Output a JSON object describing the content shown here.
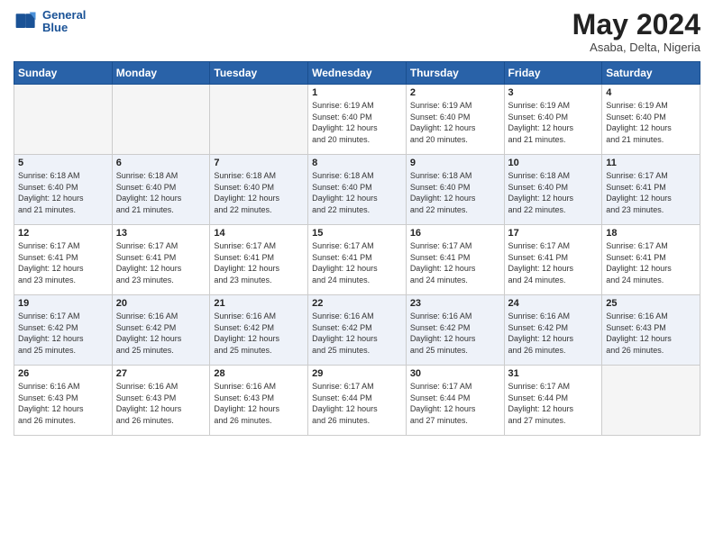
{
  "logo": {
    "line1": "General",
    "line2": "Blue"
  },
  "title": "May 2024",
  "subtitle": "Asaba, Delta, Nigeria",
  "weekdays": [
    "Sunday",
    "Monday",
    "Tuesday",
    "Wednesday",
    "Thursday",
    "Friday",
    "Saturday"
  ],
  "weeks": [
    [
      {
        "day": "",
        "info": ""
      },
      {
        "day": "",
        "info": ""
      },
      {
        "day": "",
        "info": ""
      },
      {
        "day": "1",
        "info": "Sunrise: 6:19 AM\nSunset: 6:40 PM\nDaylight: 12 hours\nand 20 minutes."
      },
      {
        "day": "2",
        "info": "Sunrise: 6:19 AM\nSunset: 6:40 PM\nDaylight: 12 hours\nand 20 minutes."
      },
      {
        "day": "3",
        "info": "Sunrise: 6:19 AM\nSunset: 6:40 PM\nDaylight: 12 hours\nand 21 minutes."
      },
      {
        "day": "4",
        "info": "Sunrise: 6:19 AM\nSunset: 6:40 PM\nDaylight: 12 hours\nand 21 minutes."
      }
    ],
    [
      {
        "day": "5",
        "info": "Sunrise: 6:18 AM\nSunset: 6:40 PM\nDaylight: 12 hours\nand 21 minutes."
      },
      {
        "day": "6",
        "info": "Sunrise: 6:18 AM\nSunset: 6:40 PM\nDaylight: 12 hours\nand 21 minutes."
      },
      {
        "day": "7",
        "info": "Sunrise: 6:18 AM\nSunset: 6:40 PM\nDaylight: 12 hours\nand 22 minutes."
      },
      {
        "day": "8",
        "info": "Sunrise: 6:18 AM\nSunset: 6:40 PM\nDaylight: 12 hours\nand 22 minutes."
      },
      {
        "day": "9",
        "info": "Sunrise: 6:18 AM\nSunset: 6:40 PM\nDaylight: 12 hours\nand 22 minutes."
      },
      {
        "day": "10",
        "info": "Sunrise: 6:18 AM\nSunset: 6:40 PM\nDaylight: 12 hours\nand 22 minutes."
      },
      {
        "day": "11",
        "info": "Sunrise: 6:17 AM\nSunset: 6:41 PM\nDaylight: 12 hours\nand 23 minutes."
      }
    ],
    [
      {
        "day": "12",
        "info": "Sunrise: 6:17 AM\nSunset: 6:41 PM\nDaylight: 12 hours\nand 23 minutes."
      },
      {
        "day": "13",
        "info": "Sunrise: 6:17 AM\nSunset: 6:41 PM\nDaylight: 12 hours\nand 23 minutes."
      },
      {
        "day": "14",
        "info": "Sunrise: 6:17 AM\nSunset: 6:41 PM\nDaylight: 12 hours\nand 23 minutes."
      },
      {
        "day": "15",
        "info": "Sunrise: 6:17 AM\nSunset: 6:41 PM\nDaylight: 12 hours\nand 24 minutes."
      },
      {
        "day": "16",
        "info": "Sunrise: 6:17 AM\nSunset: 6:41 PM\nDaylight: 12 hours\nand 24 minutes."
      },
      {
        "day": "17",
        "info": "Sunrise: 6:17 AM\nSunset: 6:41 PM\nDaylight: 12 hours\nand 24 minutes."
      },
      {
        "day": "18",
        "info": "Sunrise: 6:17 AM\nSunset: 6:41 PM\nDaylight: 12 hours\nand 24 minutes."
      }
    ],
    [
      {
        "day": "19",
        "info": "Sunrise: 6:17 AM\nSunset: 6:42 PM\nDaylight: 12 hours\nand 25 minutes."
      },
      {
        "day": "20",
        "info": "Sunrise: 6:16 AM\nSunset: 6:42 PM\nDaylight: 12 hours\nand 25 minutes."
      },
      {
        "day": "21",
        "info": "Sunrise: 6:16 AM\nSunset: 6:42 PM\nDaylight: 12 hours\nand 25 minutes."
      },
      {
        "day": "22",
        "info": "Sunrise: 6:16 AM\nSunset: 6:42 PM\nDaylight: 12 hours\nand 25 minutes."
      },
      {
        "day": "23",
        "info": "Sunrise: 6:16 AM\nSunset: 6:42 PM\nDaylight: 12 hours\nand 25 minutes."
      },
      {
        "day": "24",
        "info": "Sunrise: 6:16 AM\nSunset: 6:42 PM\nDaylight: 12 hours\nand 26 minutes."
      },
      {
        "day": "25",
        "info": "Sunrise: 6:16 AM\nSunset: 6:43 PM\nDaylight: 12 hours\nand 26 minutes."
      }
    ],
    [
      {
        "day": "26",
        "info": "Sunrise: 6:16 AM\nSunset: 6:43 PM\nDaylight: 12 hours\nand 26 minutes."
      },
      {
        "day": "27",
        "info": "Sunrise: 6:16 AM\nSunset: 6:43 PM\nDaylight: 12 hours\nand 26 minutes."
      },
      {
        "day": "28",
        "info": "Sunrise: 6:16 AM\nSunset: 6:43 PM\nDaylight: 12 hours\nand 26 minutes."
      },
      {
        "day": "29",
        "info": "Sunrise: 6:17 AM\nSunset: 6:44 PM\nDaylight: 12 hours\nand 26 minutes."
      },
      {
        "day": "30",
        "info": "Sunrise: 6:17 AM\nSunset: 6:44 PM\nDaylight: 12 hours\nand 27 minutes."
      },
      {
        "day": "31",
        "info": "Sunrise: 6:17 AM\nSunset: 6:44 PM\nDaylight: 12 hours\nand 27 minutes."
      },
      {
        "day": "",
        "info": ""
      }
    ]
  ]
}
